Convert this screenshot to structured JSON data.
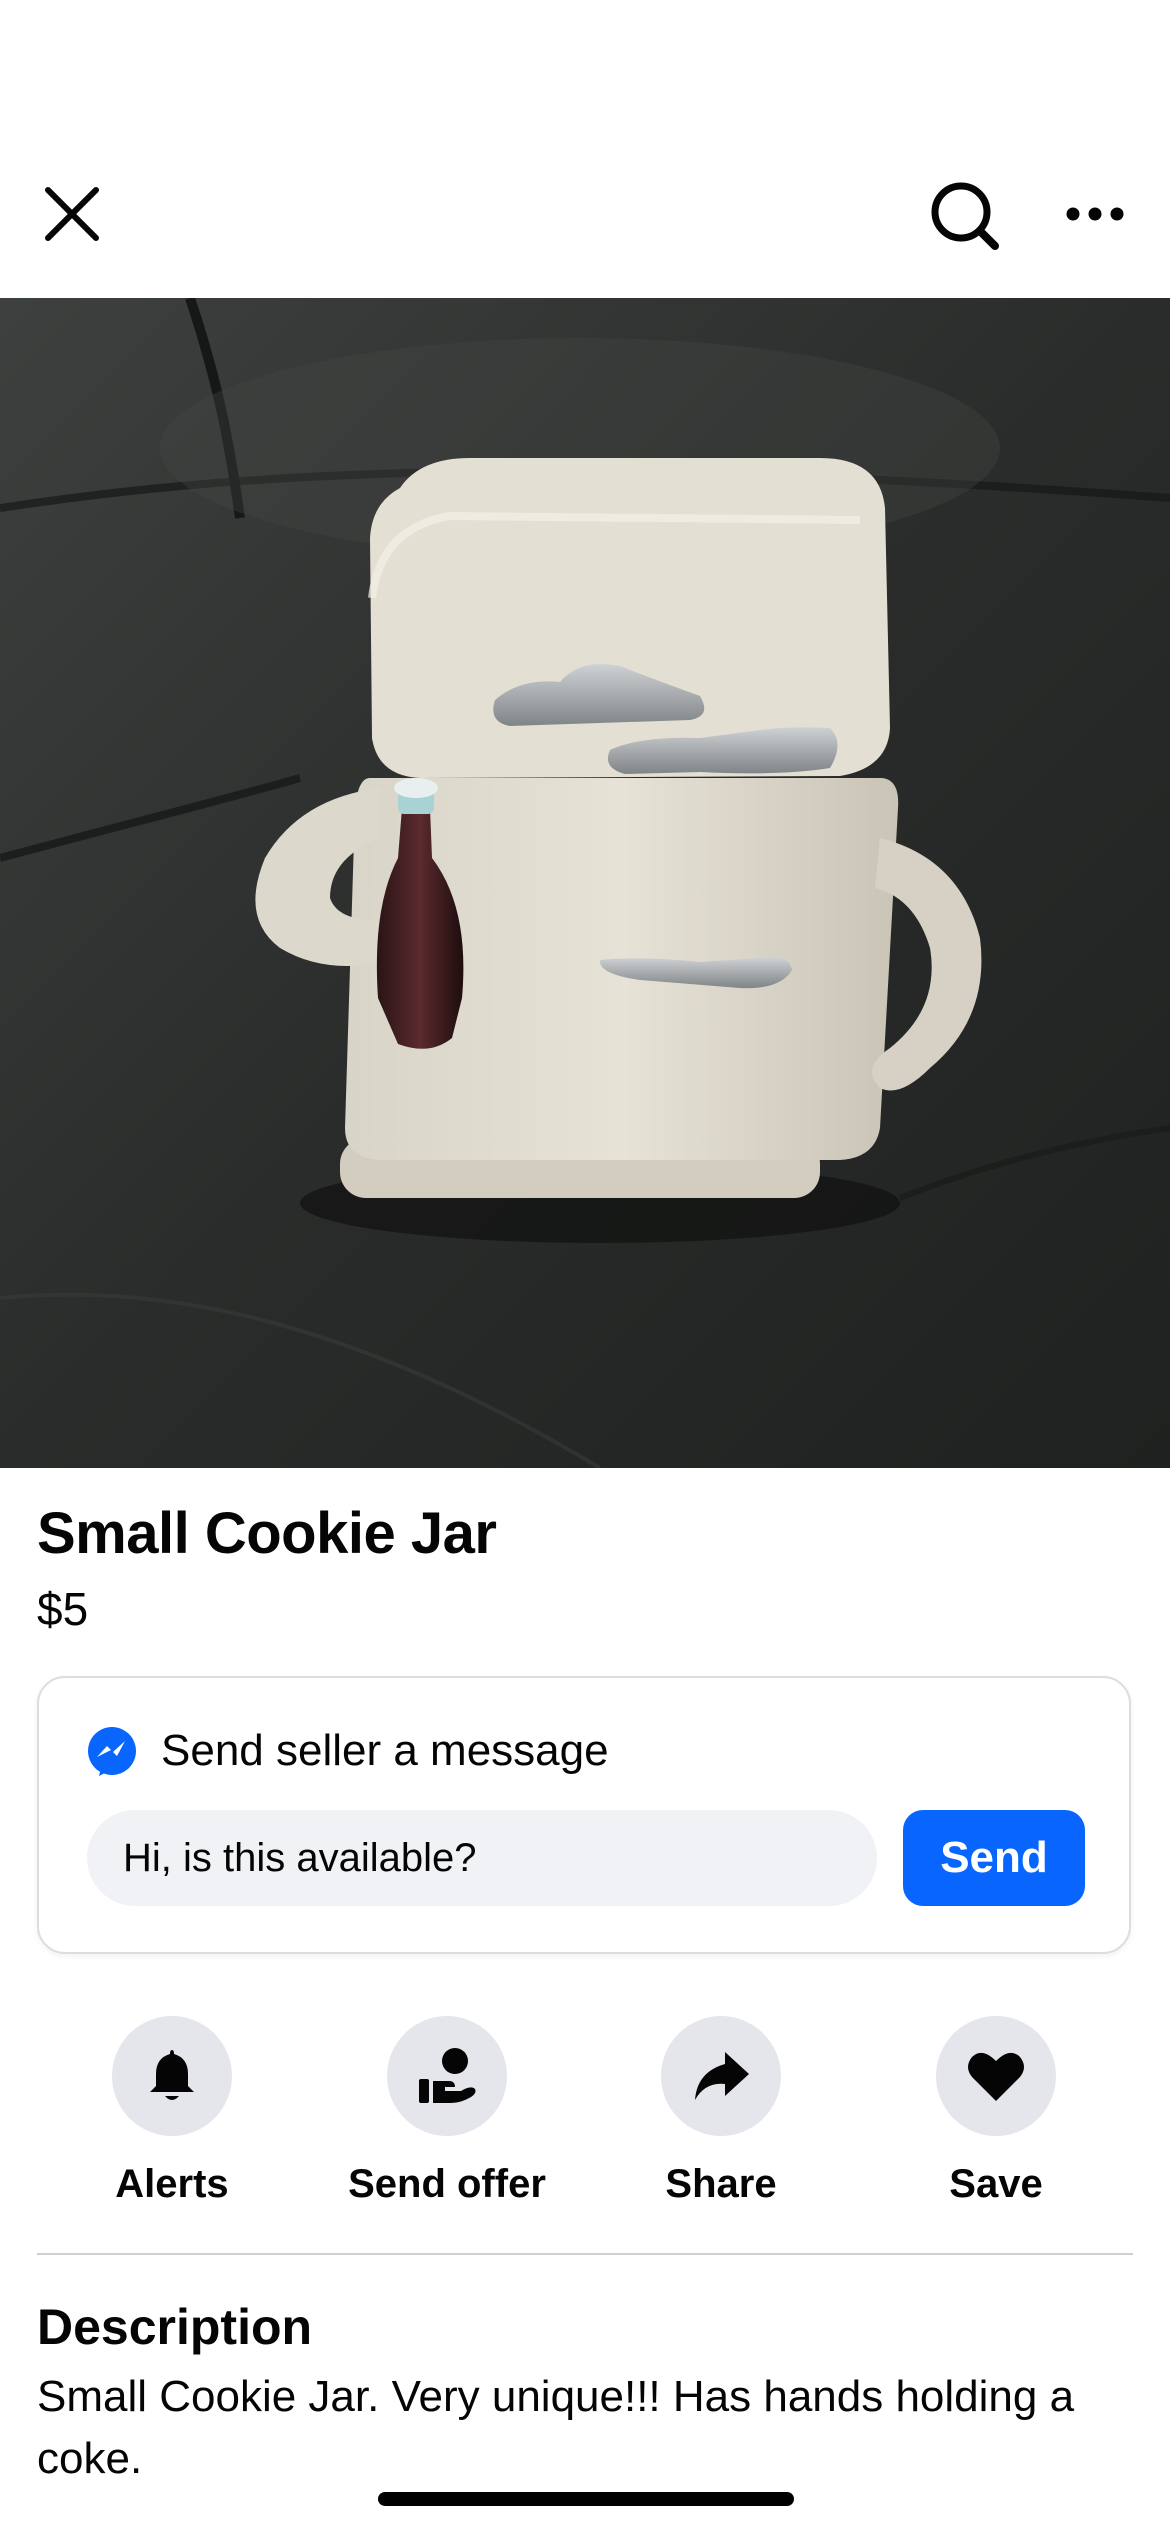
{
  "topbar": {
    "close_icon": "close-icon",
    "search_icon": "search-icon",
    "more_icon": "more-horizontal-icon"
  },
  "photo": {
    "alt": "Small Cookie Jar"
  },
  "listing": {
    "title": "Small Cookie Jar",
    "price": "$5"
  },
  "message": {
    "heading": "Send seller a message",
    "icon": "messenger-icon",
    "input_value": "Hi, is this available?",
    "send_label": "Send"
  },
  "actions": [
    {
      "label": "Alerts",
      "icon": "bell-icon"
    },
    {
      "label": "Send offer",
      "icon": "offer-hand-icon"
    },
    {
      "label": "Share",
      "icon": "share-arrow-icon"
    },
    {
      "label": "Save",
      "icon": "heart-icon"
    }
  ],
  "description": {
    "heading": "Description",
    "text": "Small Cookie Jar. Very unique!!! Has hands holding a coke."
  },
  "colors": {
    "accent": "#0866ff",
    "action_circle": "#e4e6eb",
    "input_bg": "#f0f2f5"
  }
}
